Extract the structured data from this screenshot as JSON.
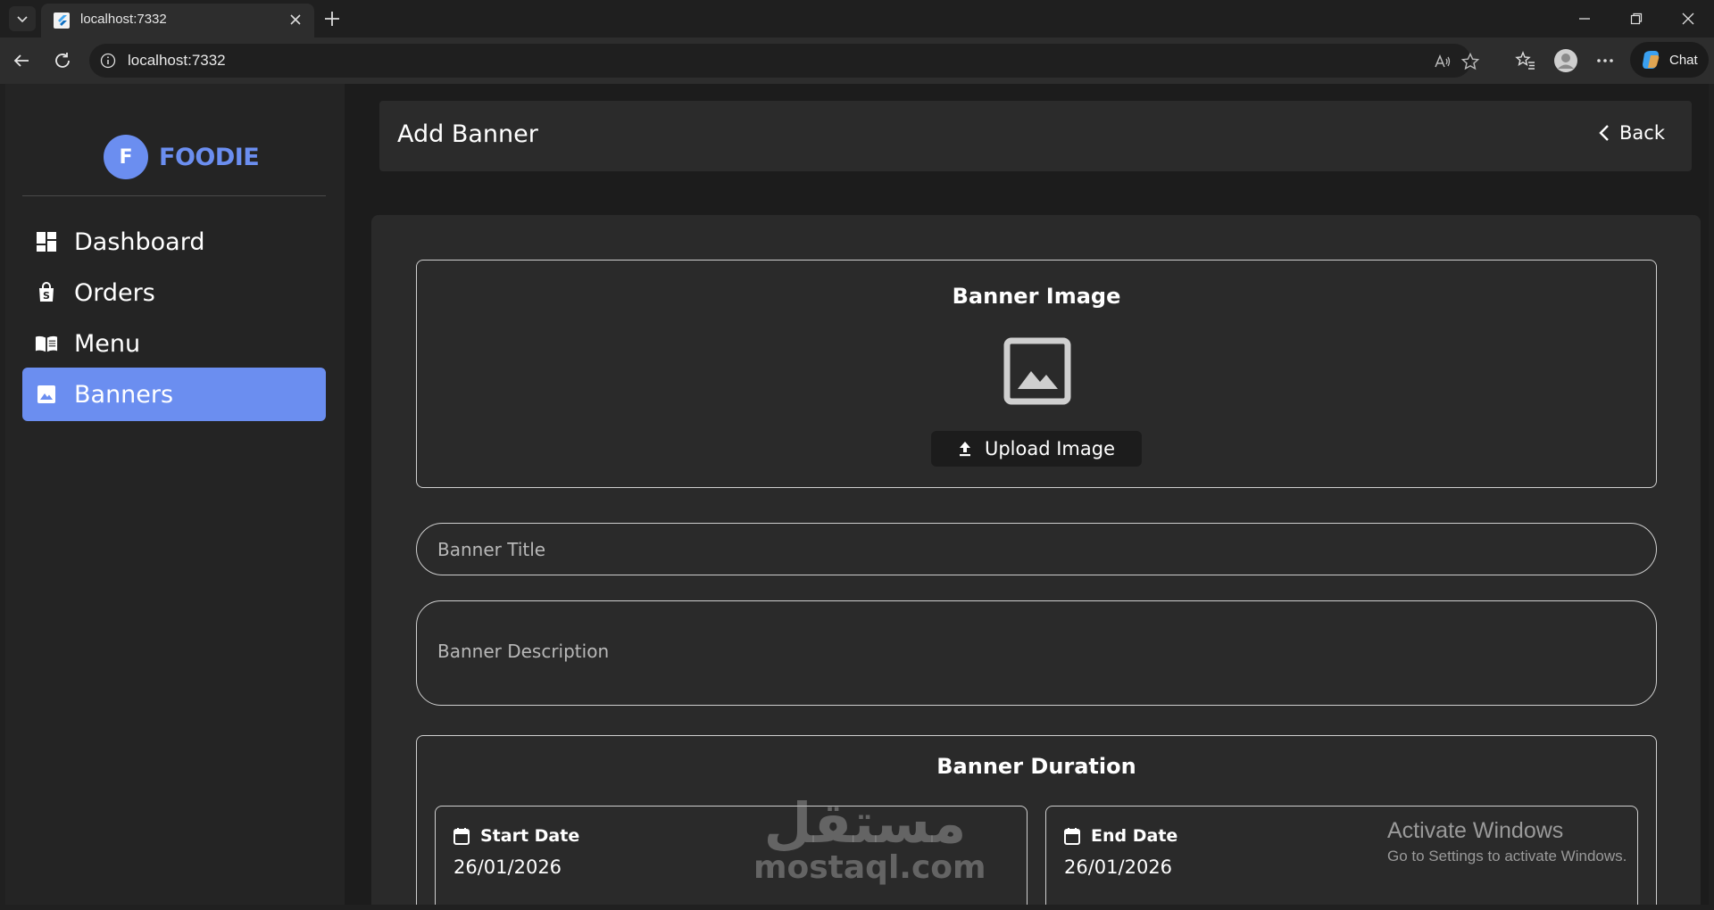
{
  "browser": {
    "tab_title": "localhost:7332",
    "url": "localhost:7332",
    "chat_label": "Chat"
  },
  "sidebar": {
    "logo_letter": "F",
    "logo_text": "FOODIE",
    "items": [
      {
        "label": "Dashboard",
        "icon": "dashboard-icon",
        "active": false
      },
      {
        "label": "Orders",
        "icon": "shopping-bag-icon",
        "active": false
      },
      {
        "label": "Menu",
        "icon": "menu-book-icon",
        "active": false
      },
      {
        "label": "Banners",
        "icon": "image-icon",
        "active": true
      }
    ]
  },
  "header": {
    "title": "Add Banner",
    "back_label": "Back"
  },
  "form": {
    "image_section_title": "Banner Image",
    "upload_label": "Upload Image",
    "title_placeholder": "Banner Title",
    "description_placeholder": "Banner Description",
    "duration_title": "Banner Duration",
    "start_label": "Start Date",
    "start_value": "26/01/2026",
    "end_label": "End Date",
    "end_value": "26/01/2026"
  },
  "overlay": {
    "watermark_arabic": "مستقل",
    "watermark_latin": "mostaql.com",
    "activate_title": "Activate Windows",
    "activate_subtitle": "Go to Settings to activate Windows."
  },
  "colors": {
    "accent": "#6b8ef0",
    "sidebar_bg": "#242424",
    "card_bg": "#2a2a2a",
    "border": "#cfcfcf"
  }
}
